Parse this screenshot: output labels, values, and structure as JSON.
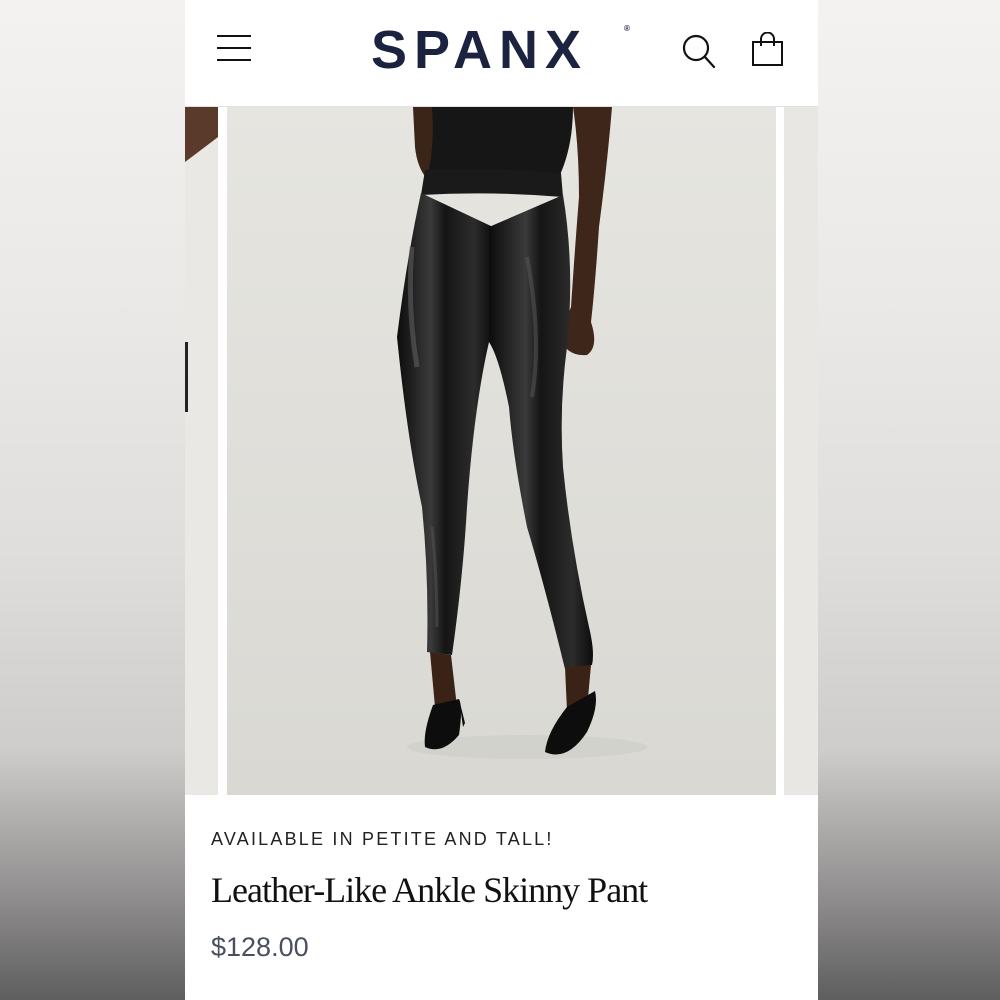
{
  "brand": {
    "logo_text": "SPANX",
    "registered_mark": "®"
  },
  "header": {
    "menu_icon": "hamburger-menu-icon",
    "search_icon": "search-icon",
    "bag_icon": "shopping-bag-icon"
  },
  "product": {
    "promo": "AVAILABLE IN PETITE AND TALL!",
    "title": "Leather-Like Ankle Skinny Pant",
    "price": "$128.00"
  },
  "colors": {
    "brand_navy": "#1b2340",
    "price_gray": "#4a4f60",
    "pant_black": "#111111"
  }
}
